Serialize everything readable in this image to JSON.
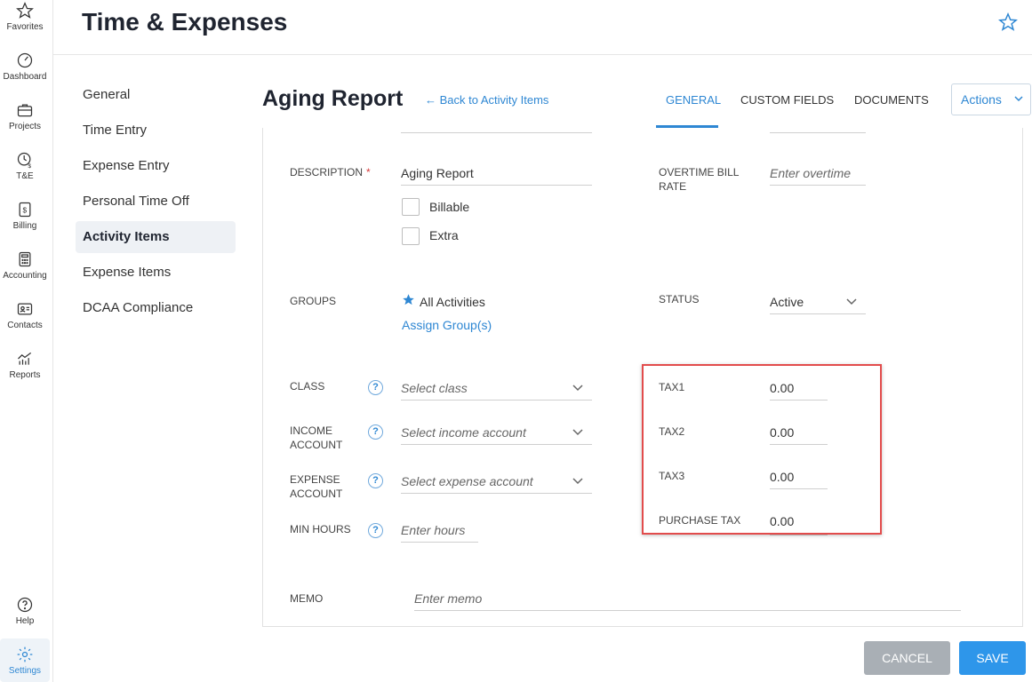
{
  "rail": {
    "items": [
      {
        "label": "Favorites",
        "icon": "star-icon"
      },
      {
        "label": "Dashboard",
        "icon": "dashboard-icon"
      },
      {
        "label": "Projects",
        "icon": "briefcase-icon"
      },
      {
        "label": "T&E",
        "icon": "clock-dollar-icon"
      },
      {
        "label": "Billing",
        "icon": "invoice-icon"
      },
      {
        "label": "Accounting",
        "icon": "calculator-icon"
      },
      {
        "label": "Contacts",
        "icon": "contact-card-icon"
      },
      {
        "label": "Reports",
        "icon": "chart-icon"
      },
      {
        "label": "Help",
        "icon": "help-icon"
      },
      {
        "label": "Settings",
        "icon": "gear-icon"
      }
    ],
    "active": "Settings"
  },
  "header": {
    "title": "Time & Expenses"
  },
  "subnav": {
    "items": [
      "General",
      "Time Entry",
      "Expense Entry",
      "Personal Time Off",
      "Activity Items",
      "Expense Items",
      "DCAA Compliance"
    ],
    "active": "Activity Items"
  },
  "page": {
    "title": "Aging Report",
    "back_link": "← Back to Activity Items",
    "tabs": [
      "GENERAL",
      "CUSTOM FIELDS",
      "DOCUMENTS"
    ],
    "active_tab": "GENERAL",
    "actions_label": "Actions"
  },
  "form": {
    "description": {
      "label": "DESCRIPTION",
      "required": "*",
      "value": "Aging Report"
    },
    "billable_label": "Billable",
    "extra_label": "Extra",
    "overtime": {
      "label_line1": "OVERTIME BILL",
      "label_line2": "RATE",
      "placeholder": "Enter overtime"
    },
    "groups": {
      "label": "GROUPS",
      "value": "All Activities",
      "assign_link": "Assign Group(s)"
    },
    "status": {
      "label": "STATUS",
      "value": "Active"
    },
    "class": {
      "label": "CLASS",
      "placeholder": "Select class"
    },
    "income": {
      "label_line1": "INCOME",
      "label_line2": "ACCOUNT",
      "placeholder": "Select income account"
    },
    "expense": {
      "label_line1": "EXPENSE",
      "label_line2": "ACCOUNT",
      "placeholder": "Select expense account"
    },
    "min_hours": {
      "label": "MIN HOURS",
      "placeholder": "Enter hours"
    },
    "tax1": {
      "label": "TAX1",
      "value": "0.00"
    },
    "tax2": {
      "label": "TAX2",
      "value": "0.00"
    },
    "tax3": {
      "label": "TAX3",
      "value": "0.00"
    },
    "purchase_tax": {
      "label": "PURCHASE TAX",
      "value": "0.00"
    },
    "memo": {
      "label": "MEMO",
      "placeholder": "Enter memo"
    },
    "help_glyph": "?"
  },
  "footer": {
    "cancel_label": "CANCEL",
    "save_label": "SAVE"
  },
  "colors": {
    "accent": "#2e87d3",
    "highlight": "#e24c4c",
    "cancel": "#a9afb5",
    "save": "#2e96ea"
  }
}
